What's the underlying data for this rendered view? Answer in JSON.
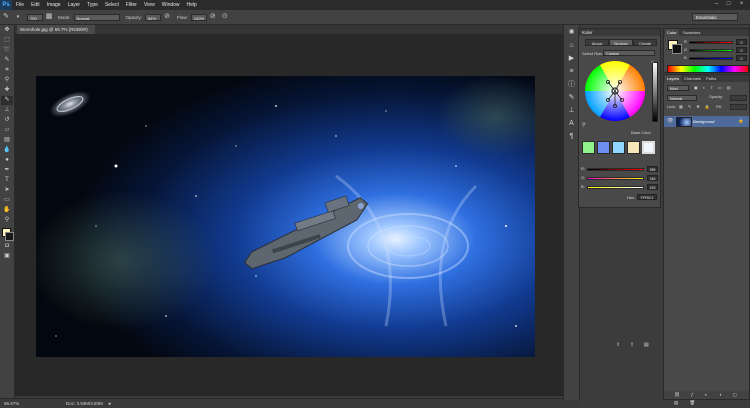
{
  "app": {
    "logo": "Ps"
  },
  "menu": [
    "File",
    "Edit",
    "Image",
    "Layer",
    "Type",
    "Select",
    "Filter",
    "View",
    "Window",
    "Help"
  ],
  "window_controls": {
    "minimize": "–",
    "maximize": "□",
    "close": "×"
  },
  "options": {
    "brush_size": "700",
    "mode_label": "Mode:",
    "mode_value": "Normal",
    "opacity_label": "Opacity:",
    "opacity_value": "84%",
    "flow_label": "Flow:",
    "flow_value": "100%",
    "workspace": "Essentials"
  },
  "document": {
    "tab_title": "Wormhole.jpg @ 66.7% (RGB/8#)",
    "zoom": "66.67%",
    "doc_info": "Doc: 3.93M/3.93M"
  },
  "kuler": {
    "title": "Kuler",
    "tabs": [
      "About",
      "Browse",
      "Create"
    ],
    "rule_label": "Select Rule:",
    "rule_value": "Custom",
    "base_color_label": "Base Color",
    "swatches": [
      "#8ff28a",
      "#6e8ff2",
      "#8fd7ff",
      "#f5e6b8",
      "#f2f6ff"
    ],
    "sliders": [
      {
        "label": "R:",
        "value": "255",
        "color": "#d94040"
      },
      {
        "label": "G:",
        "value": "246",
        "color": "#3bbf3b"
      },
      {
        "label": "B:",
        "value": "193",
        "color": "#3b5bd9"
      }
    ],
    "hex_label": "Hex:",
    "hex_value": "FFF6C1"
  },
  "color_panel": {
    "tabs": [
      "Color",
      "Swatches"
    ],
    "channels": [
      {
        "label": "R",
        "value": "0"
      },
      {
        "label": "G",
        "value": "0"
      },
      {
        "label": "B",
        "value": "0"
      }
    ]
  },
  "layers": {
    "tabs": [
      "Layers",
      "Channels",
      "Paths"
    ],
    "kind_label": "Kind",
    "blend_mode": "Normal",
    "opacity_label": "Opacity:",
    "lock_label": "Lock:",
    "fill_label": "Fill:",
    "layer_name": "Background"
  }
}
